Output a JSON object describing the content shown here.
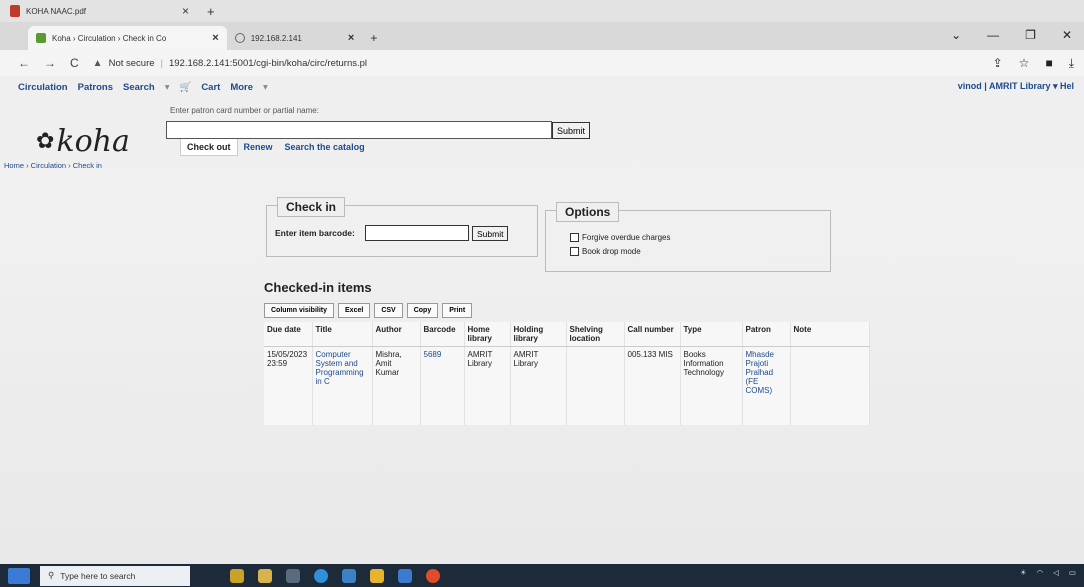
{
  "outer_tab": {
    "title": "KOHA NAAC.pdf"
  },
  "browser": {
    "tabs": [
      {
        "title": "Koha › Circulation › Check in Co"
      },
      {
        "title": "192.168.2.141"
      }
    ],
    "address": {
      "security": "Not secure",
      "url": "192.168.2.141:5001/cgi-bin/koha/circ/returns.pl"
    }
  },
  "koha_nav": {
    "items": [
      "Circulation",
      "Patrons",
      "Search",
      "Cart",
      "More"
    ],
    "user": "vinod | AMRIT Library ▾  Hel"
  },
  "header": {
    "logo": "koha",
    "search_hint": "Enter patron card number or partial name:",
    "search_submit": "Submit",
    "tabs": [
      "Check out",
      "Renew",
      "Search the catalog"
    ]
  },
  "breadcrumb": "Home › Circulation › Check in",
  "checkin": {
    "legend": "Check in",
    "barcode_label": "Enter item barcode:",
    "submit": "Submit"
  },
  "options": {
    "legend": "Options",
    "items": [
      "Forgive overdue charges",
      "Book drop mode"
    ]
  },
  "checked_in": {
    "title": "Checked-in items",
    "buttons": [
      "Column visibility",
      "Excel",
      "CSV",
      "Copy",
      "Print"
    ],
    "columns": [
      "Due date",
      "Title",
      "Author",
      "Barcode",
      "Home library",
      "Holding library",
      "Shelving location",
      "Call number",
      "Type",
      "Patron",
      "Note"
    ],
    "rows": [
      [
        "15/05/2023 23:59",
        "Computer System and Programming in C",
        "Mishra, Amit Kumar",
        "5689",
        "AMRIT Library",
        "AMRIT Library",
        "",
        "005.133 MIS",
        "Books Information Technology",
        "Mhasde Prajoti Pralhad (FE COMS)",
        ""
      ]
    ]
  },
  "taskbar": {
    "search_placeholder": "Type here to search"
  }
}
